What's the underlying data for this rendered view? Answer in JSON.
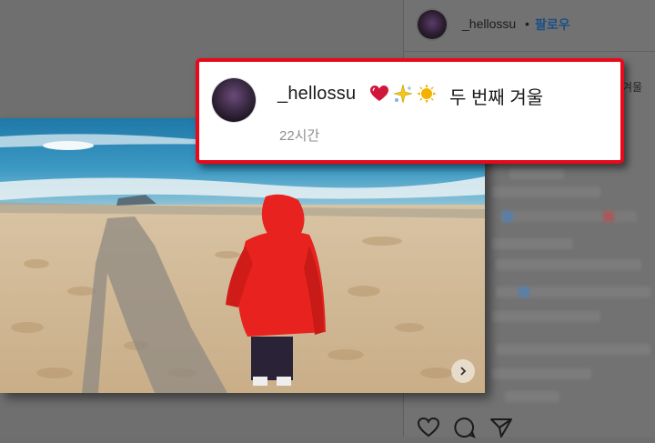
{
  "header": {
    "username": "_hellossu",
    "separator": "•",
    "follow_label": "팔로우"
  },
  "side_snippet": "겨울",
  "caption": {
    "username": "_hellossu",
    "emojis": [
      "heart-icon",
      "sparkles-icon",
      "sun-icon"
    ],
    "text": "두 번째 겨울",
    "time": "22시간"
  },
  "actions": [
    "heart-icon",
    "comment-icon",
    "share-icon"
  ],
  "colors": {
    "highlight_border": "#e8091a",
    "follow_link": "#1d4f86",
    "jacket": "#e8231f"
  }
}
